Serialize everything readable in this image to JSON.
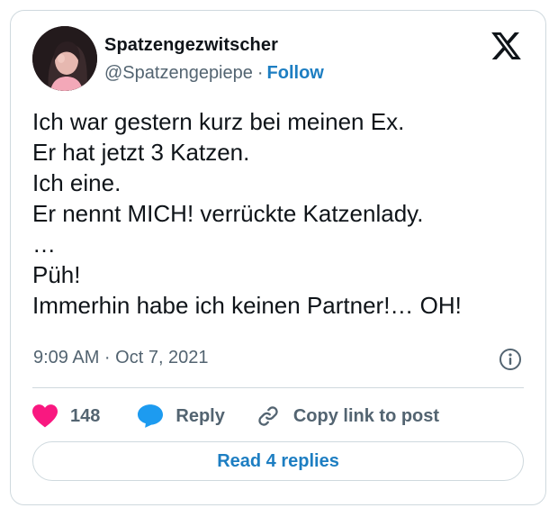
{
  "author": {
    "display_name": "Spatzengezwitscher",
    "handle": "@Spatzengepiepe",
    "separator": "·",
    "follow_label": "Follow"
  },
  "tweet": {
    "text": "Ich war gestern kurz bei meinen Ex.\nEr hat jetzt 3 Katzen.\nIch eine.\nEr nennt MICH! verrückte Katzenlady.\n…\nPüh!\nImmerhin habe ich keinen Partner!… OH!",
    "timestamp": "9:09 AM · Oct 7, 2021"
  },
  "actions": {
    "like_count": "148",
    "reply_label": "Reply",
    "copy_link_label": "Copy link to post"
  },
  "footer": {
    "read_replies_label": "Read 4 replies"
  },
  "colors": {
    "like": "#f91880",
    "reply": "#1d9bf0",
    "link": "#1d7ec2",
    "muted": "#536471",
    "border": "#cfd9de"
  },
  "icons": [
    "x-logo-icon",
    "info-icon",
    "heart-icon",
    "speech-bubble-icon",
    "link-icon"
  ]
}
